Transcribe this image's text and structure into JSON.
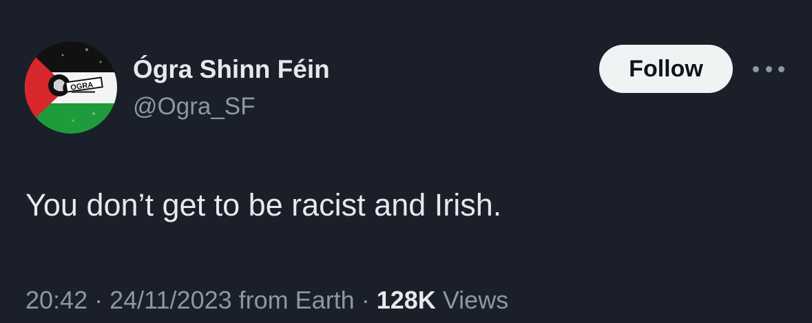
{
  "author": {
    "display_name": "Ógra Shinn Féin",
    "handle": "@Ogra_SF",
    "avatar": {
      "icon": "ogra-flag-avatar-icon",
      "logo_text": "OGRA",
      "colors": {
        "black": "#111111",
        "white": "#f4f4f4",
        "green": "#1e9b3a",
        "red": "#d7262c"
      }
    }
  },
  "actions": {
    "follow_label": "Follow",
    "more_icon": "more-horizontal-icon"
  },
  "tweet": {
    "text": "You don’t get to be racist and Irish."
  },
  "meta": {
    "time": "20:42",
    "separator": "·",
    "date": "24/11/2023",
    "source": "from Earth",
    "views_count": "128K",
    "views_label": "Views"
  },
  "colors": {
    "background": "#1a1f2a",
    "primary_text": "#e7e9ea",
    "secondary_text": "#8b98a5",
    "follow_bg": "#eff3f4"
  }
}
